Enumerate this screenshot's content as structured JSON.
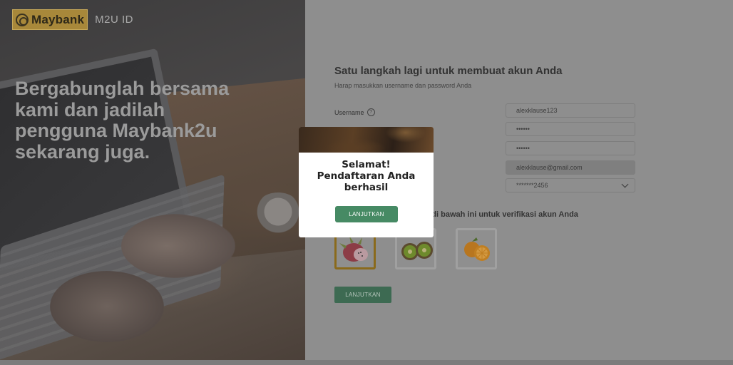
{
  "brand": {
    "logo_text": "Maybank",
    "product": "M2U ID"
  },
  "hero": {
    "headline": "Bergabunglah bersama kami dan jadilah pengguna Maybank2u sekarang juga."
  },
  "form": {
    "title": "Satu langkah lagi untuk membuat akun Anda",
    "subtitle": "Harap masukkan username dan password Anda",
    "username_label": "Username",
    "username_value": "alexklause123",
    "password_value": "••••••",
    "confirm_password_value": "••••••",
    "email_value": "alexklause@gmail.com",
    "account_value": "*******2456",
    "verify_text": "r di bawah ini untuk verifikasi akun Anda",
    "fruit_options": [
      "dragon-fruit",
      "kiwi",
      "orange"
    ],
    "selected_fruit": "dragon-fruit",
    "continue_label": "LANJUTKAN"
  },
  "modal": {
    "line1": "Selamat!",
    "line2": "Pendaftaran Anda",
    "line3": "berhasil",
    "button_label": "LANJUTKAN"
  },
  "colors": {
    "accent": "#468a64",
    "brand_gold": "#a8883a"
  }
}
